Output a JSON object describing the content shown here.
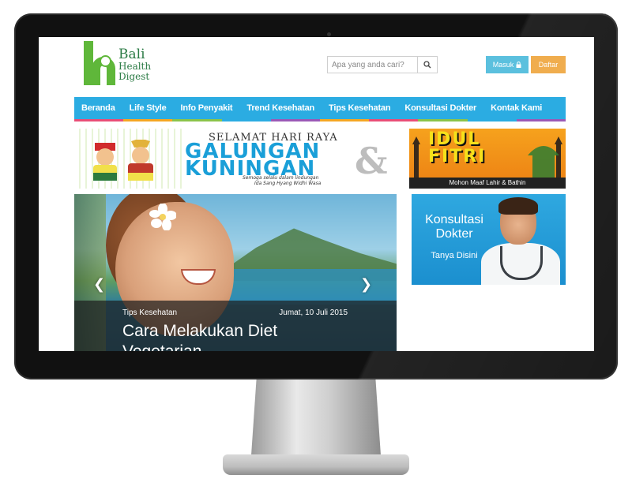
{
  "logo": {
    "line1": "Bali",
    "line2": "Health",
    "line3": "Digest"
  },
  "search": {
    "placeholder": "Apa yang anda cari?"
  },
  "auth": {
    "login_label": "Masuk",
    "register_label": "Daftar"
  },
  "nav": {
    "items": [
      {
        "label": "Beranda"
      },
      {
        "label": "Life Style"
      },
      {
        "label": "Info Penyakit"
      },
      {
        "label": "Trend Kesehatan"
      },
      {
        "label": "Tips Kesehatan"
      },
      {
        "label": "Konsultasi Dokter"
      },
      {
        "label": "Kontak Kami"
      }
    ],
    "stripe_colors": [
      "#e94e77",
      "#f5a623",
      "#8bc34a",
      "#2bace2",
      "#9b59b6",
      "#f5a623",
      "#e94e77",
      "#8bc34a",
      "#2bace2",
      "#9b59b6"
    ]
  },
  "banner": {
    "title": "SELAMAT HARI RAYA",
    "line1": "GALUNGAN",
    "line2": "KUNINGAN",
    "sub1": "Semoga selalu dalam lindungan",
    "sub2": "Ida Sang Hyang Widhi Wasa",
    "amp": "&",
    "right_line1": "IDUL",
    "right_line2": "FITRI",
    "right_footer": "Mohon Maaf Lahir & Bathin"
  },
  "slider": {
    "category": "Tips Kesehatan",
    "date": "Jumat, 10 Juli 2015",
    "title": "Cara Melakukan Diet Vegetarian"
  },
  "consult": {
    "title_line1": "Konsultasi",
    "title_line2": "Dokter",
    "subtitle": "Tanya Disini"
  },
  "colors": {
    "nav_bg": "#2bace2",
    "login_bg": "#5bc0de",
    "register_bg": "#f0ad4e",
    "logo_green": "#5fb73a"
  }
}
